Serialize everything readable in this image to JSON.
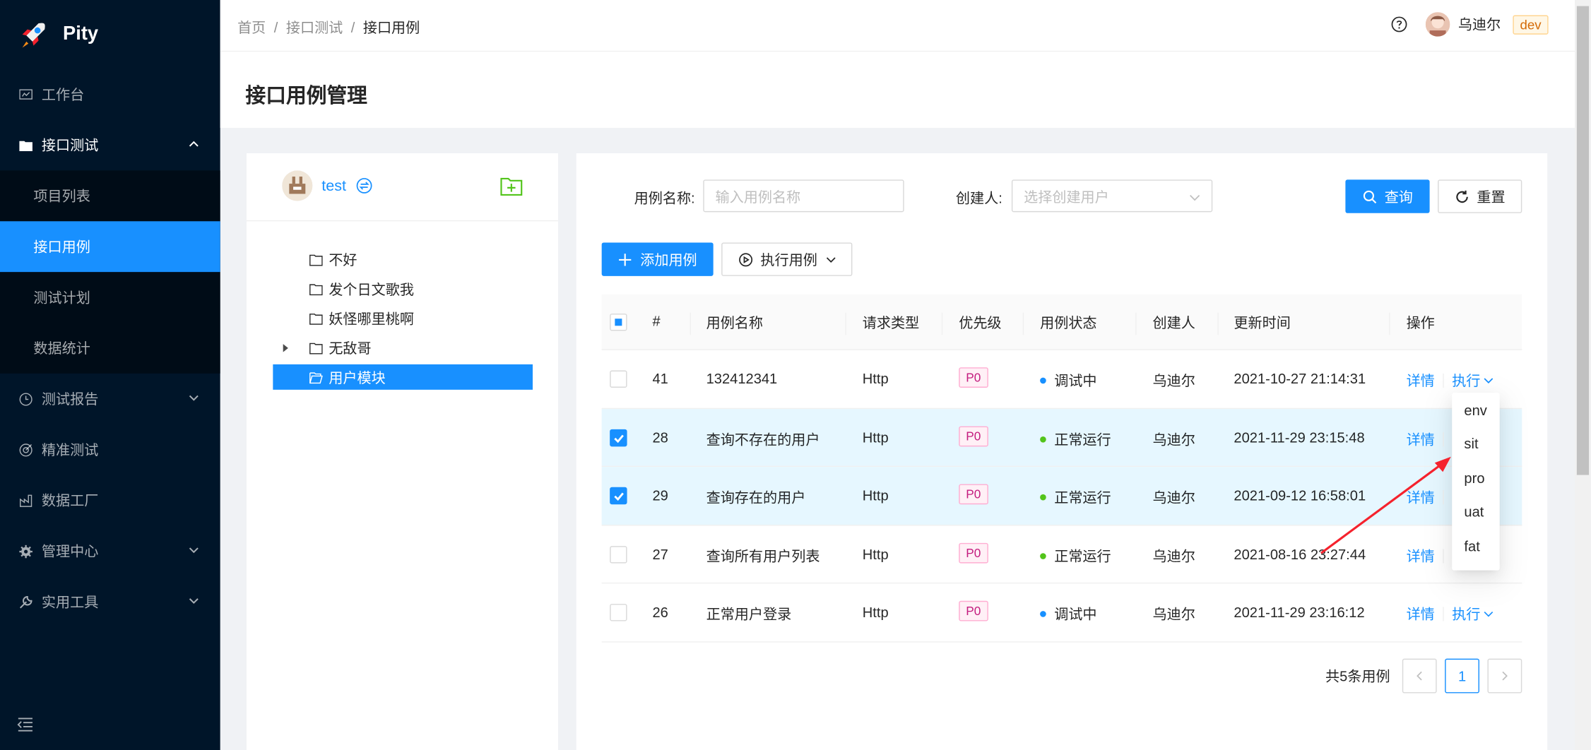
{
  "app": {
    "name": "Pity"
  },
  "sidebar": {
    "items": [
      {
        "label": "工作台",
        "icon": "dashboard-icon"
      },
      {
        "label": "接口测试",
        "icon": "folder-icon",
        "expanded": true,
        "children": [
          {
            "label": "项目列表"
          },
          {
            "label": "接口用例",
            "active": true
          },
          {
            "label": "测试计划"
          },
          {
            "label": "数据统计"
          }
        ]
      },
      {
        "label": "测试报告",
        "icon": "clock-icon"
      },
      {
        "label": "精准测试",
        "icon": "target-icon"
      },
      {
        "label": "数据工厂",
        "icon": "factory-icon"
      },
      {
        "label": "管理中心",
        "icon": "gear-icon"
      },
      {
        "label": "实用工具",
        "icon": "wrench-icon"
      }
    ]
  },
  "header": {
    "breadcrumb": [
      "首页",
      "接口测试",
      "接口用例"
    ],
    "separator": "/",
    "user": "乌迪尔",
    "env": "dev"
  },
  "page": {
    "title": "接口用例管理"
  },
  "tree": {
    "project": "test",
    "nodes": [
      {
        "label": "不好"
      },
      {
        "label": "发个日文歌我"
      },
      {
        "label": "妖怪哪里桃啊"
      },
      {
        "label": "无敌哥",
        "has_children": true
      },
      {
        "label": "用户模块",
        "selected": true
      }
    ]
  },
  "filters": {
    "name_label": "用例名称:",
    "name_placeholder": "输入用例名称",
    "creator_label": "创建人:",
    "creator_placeholder": "选择创建用户",
    "search_label": "查询",
    "reset_label": "重置"
  },
  "actions": {
    "add_label": "添加用例",
    "run_label": "执行用例"
  },
  "table": {
    "columns": [
      "#",
      "用例名称",
      "请求类型",
      "优先级",
      "用例状态",
      "创建人",
      "更新时间",
      "操作"
    ],
    "rows": [
      {
        "id": "41",
        "name": "132412341",
        "type": "Http",
        "priority": "P0",
        "status": "调试中",
        "status_color": "#1890ff",
        "creator": "乌迪尔",
        "updated": "2021-10-27 21:14:31",
        "checked": false
      },
      {
        "id": "28",
        "name": "查询不存在的用户",
        "type": "Http",
        "priority": "P0",
        "status": "正常运行",
        "status_color": "#52c41a",
        "creator": "乌迪尔",
        "updated": "2021-11-29 23:15:48",
        "checked": true
      },
      {
        "id": "29",
        "name": "查询存在的用户",
        "type": "Http",
        "priority": "P0",
        "status": "正常运行",
        "status_color": "#52c41a",
        "creator": "乌迪尔",
        "updated": "2021-09-12 16:58:01",
        "checked": true
      },
      {
        "id": "27",
        "name": "查询所有用户列表",
        "type": "Http",
        "priority": "P0",
        "status": "正常运行",
        "status_color": "#52c41a",
        "creator": "乌迪尔",
        "updated": "2021-08-16 23:27:44",
        "checked": false
      },
      {
        "id": "26",
        "name": "正常用户登录",
        "type": "Http",
        "priority": "P0",
        "status": "调试中",
        "status_color": "#1890ff",
        "creator": "乌迪尔",
        "updated": "2021-11-29 23:16:12",
        "checked": false
      }
    ],
    "detail_label": "详情",
    "exec_label": "执行"
  },
  "pagination": {
    "total_text": "共5条用例",
    "current": "1"
  },
  "dropdown": {
    "options": [
      "env",
      "sit",
      "pro",
      "uat",
      "fat"
    ]
  },
  "colors": {
    "primary": "#1890ff",
    "sider": "#001529",
    "annotation": "#f5222d"
  }
}
